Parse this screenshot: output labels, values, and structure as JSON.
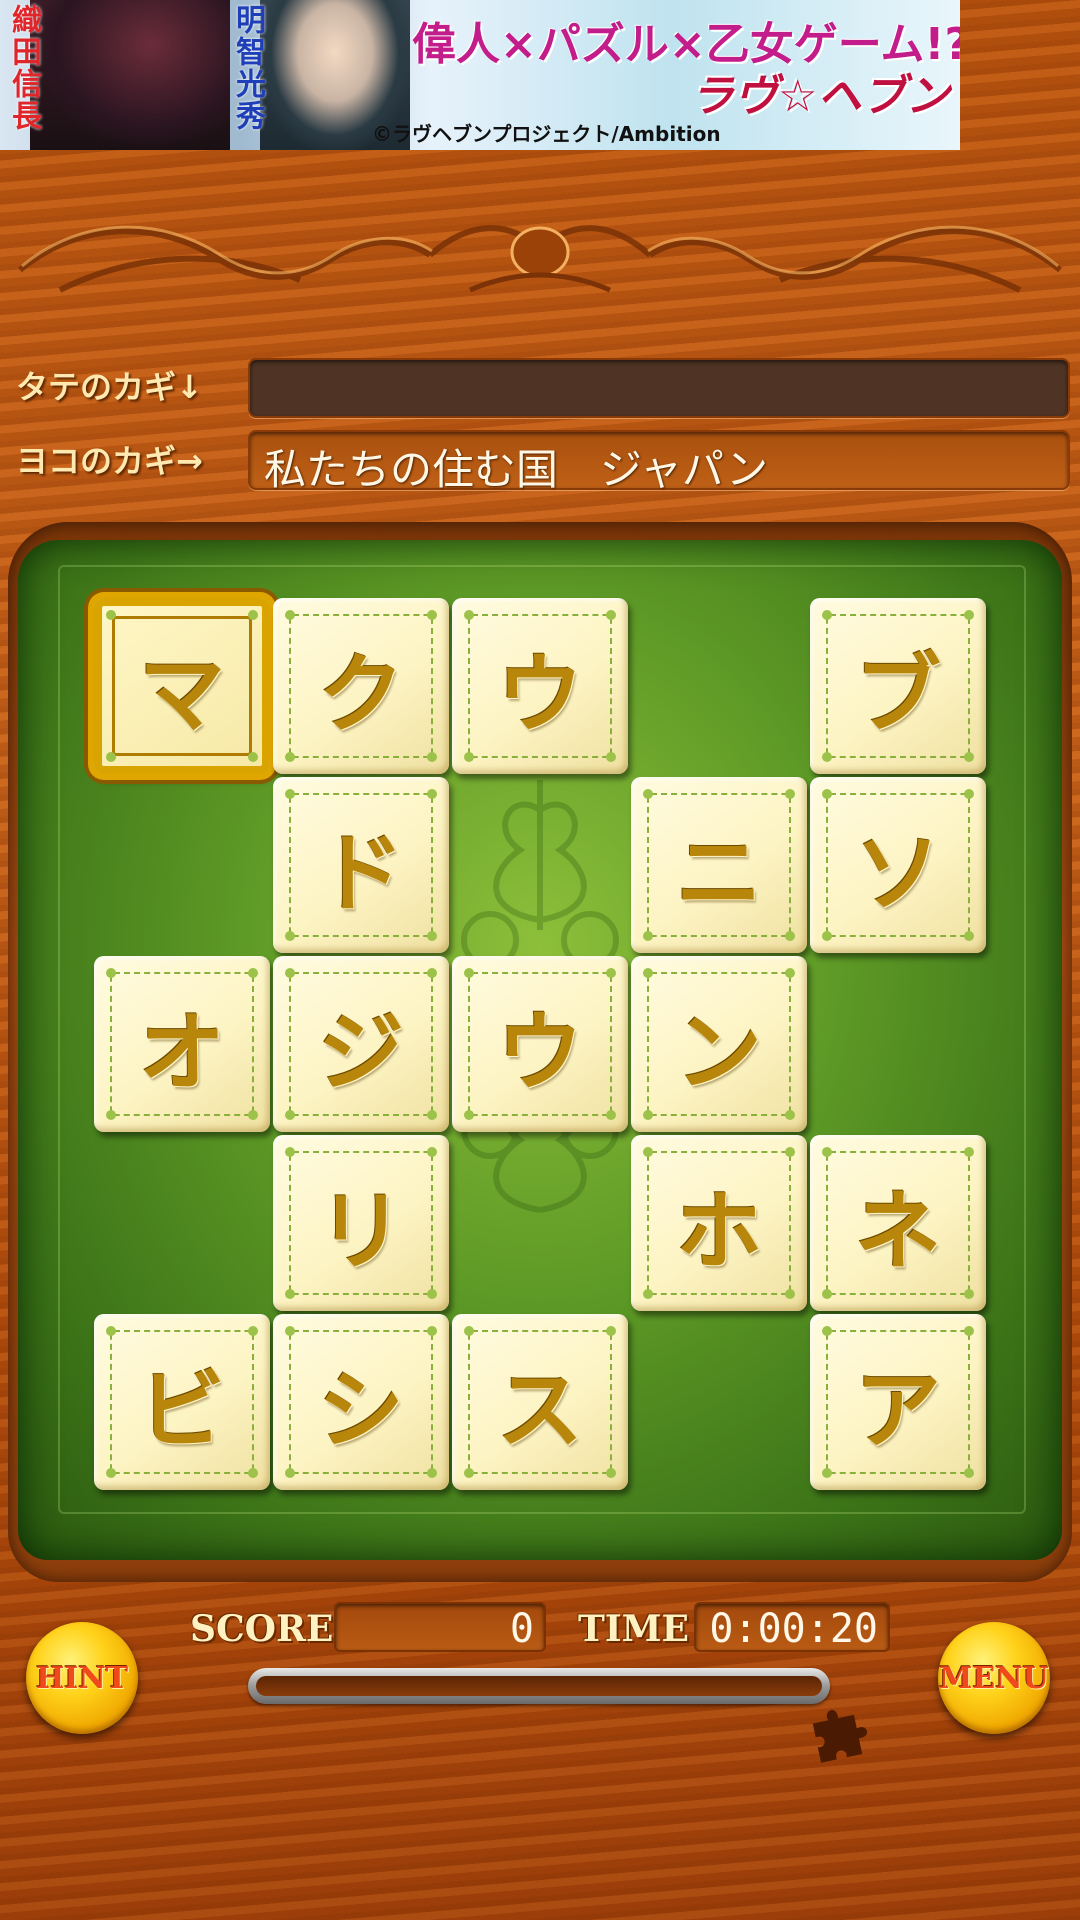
{
  "ad": {
    "vertical_name_left": "織田信長",
    "vertical_name_right": "明智光秀",
    "tagline": "偉人×パズル×乙女ゲーム!?",
    "logo": "ラヴ☆ヘブン",
    "copyright": "©ラヴヘブンプロジェクト/Ambition"
  },
  "clues": {
    "vertical_label": "タテのカギ↓",
    "vertical_text": "",
    "horizontal_label": "ヨコのカギ→",
    "horizontal_text": "私たちの住む国　ジャパン"
  },
  "grid": {
    "rows": [
      [
        "マ",
        "ク",
        "ウ",
        "",
        "ブ"
      ],
      [
        "",
        "ド",
        "",
        "ニ",
        "ソ"
      ],
      [
        "オ",
        "ジ",
        "ウ",
        "ン",
        ""
      ],
      [
        "",
        "リ",
        "",
        "ホ",
        "ネ"
      ],
      [
        "ビ",
        "シ",
        "ス",
        "",
        "ア"
      ]
    ],
    "selected": [
      0,
      0
    ]
  },
  "hud": {
    "score_label": "SCORE",
    "score": "0",
    "time_label": "TIME",
    "time": "0:00:20",
    "progress": 0,
    "hint_label": "HINT",
    "menu_label": "MENU"
  },
  "colors": {
    "wood": "#b9530e",
    "felt": "#5e9a26",
    "tile": "#fdf4c4",
    "tile_text": "#b8860b",
    "selected_border": "#e0a600"
  },
  "icons": {
    "hint_button": "lightbulb-icon",
    "menu_button": "gear-icon",
    "progress_end": "puzzle-piece-icon"
  }
}
